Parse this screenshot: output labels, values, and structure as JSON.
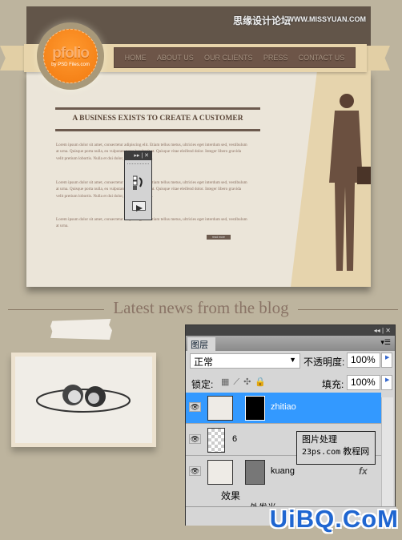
{
  "watermarks": {
    "top_cn": "思缘设计论坛",
    "top_url": "WWW.MISSYUAN.COM",
    "bottom": "UiBQ.CoM",
    "note_line1": "图片处理",
    "note_line2": "23ps.com",
    "note_line3": "教程网"
  },
  "logo": {
    "name": "pfolio",
    "sub": "by PSD Files.com"
  },
  "nav": [
    "HOME",
    "ABOUT US",
    "OUR CLIENTS",
    "PRESS",
    "CONTACT US"
  ],
  "main": {
    "heading": "A BUSINESS EXISTS TO CREATE A CUSTOMER",
    "paragraphs": [
      "Lorem ipsum dolor sit amet, consectetur adipiscing elit. Etiam tellus metus, ultricies eget interdum sed, vestibulum at urna. Quisque porta nulla, eu vulputate nunc hendrerit at. Quisque vitae eleifend dolor. Integer libero gravida velit pretium lobortis. Nulla et dui dolor, in ultrices lorem.",
      "Lorem ipsum dolor sit amet, consectetur adipiscing elit. Etiam tellus metus, ultricies eget interdum sed, vestibulum at urna. Quisque porta nulla, eu vulputate nunc hendrerit at. Quisque vitae eleifend dolor. Integer libero gravida velit pretium lobortis. Nulla et dui dolor, in ultrices lorem.",
      "Lorem ipsum dolor sit amet, consectetur adipiscing elit. Etiam tellus metus, ultricies eget interdum sed, vestibulum at urna."
    ],
    "read_more": "read more"
  },
  "mini_panel": {
    "controls": "▸▸ | ✕"
  },
  "blog": {
    "title": "Latest news from the blog"
  },
  "layers_panel": {
    "controls": "◂◂ | ✕",
    "tab": "图层",
    "blend_mode": "正常",
    "opacity_label": "不透明度:",
    "opacity": "100%",
    "lock_label": "锁定:",
    "fill_label": "填充:",
    "fill": "100%",
    "layers": [
      {
        "name": "zhitiao",
        "selected": true
      },
      {
        "name": "6",
        "selected": false
      },
      {
        "name": "kuang",
        "selected": false,
        "fx": "fx"
      }
    ],
    "effects_label": "效果",
    "effect_item": "外发光",
    "selected_color": "#3399ff"
  }
}
